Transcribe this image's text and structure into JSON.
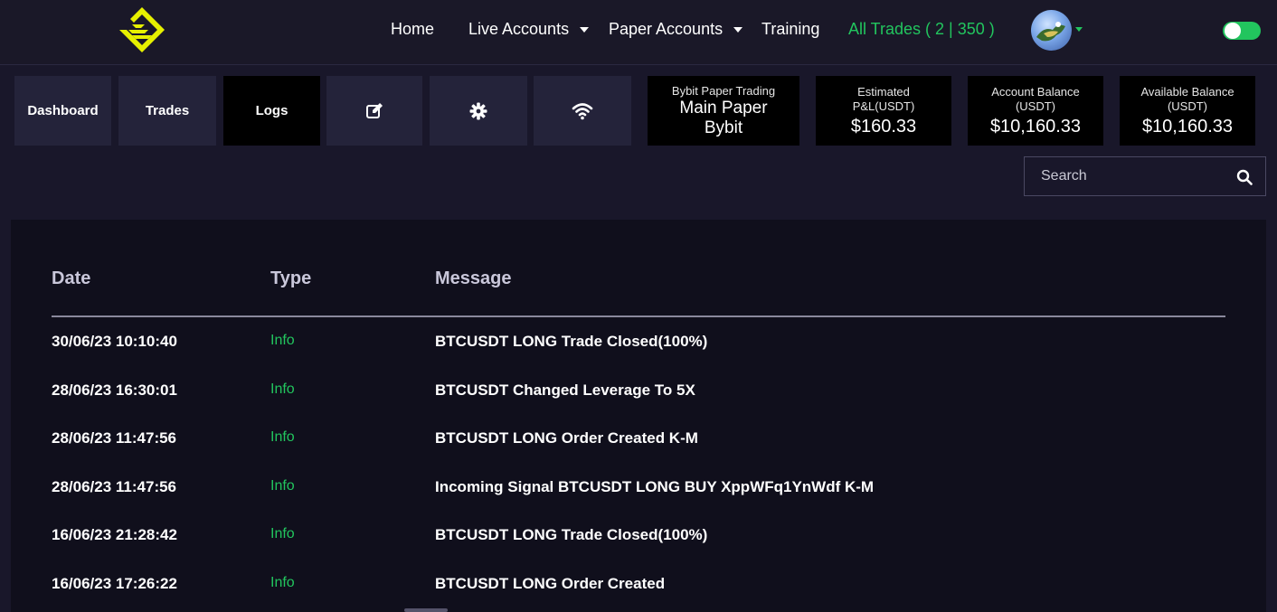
{
  "nav": {
    "home": "Home",
    "live_accounts": "Live Accounts",
    "paper_accounts": "Paper Accounts",
    "training": "Training",
    "all_trades": "All Trades ( 2 | 350 )"
  },
  "toolbar": {
    "dashboard": "Dashboard",
    "trades": "Trades",
    "logs": "Logs",
    "edit_icon": "edit-icon",
    "settings_icon": "gear-icon",
    "wifi_icon": "wifi-icon"
  },
  "account_box": {
    "label": "Bybit Paper Trading",
    "name_line1": "Main Paper",
    "name_line2": "Bybit"
  },
  "stats": [
    {
      "label_line1": "Estimated",
      "label_line2": "P&L(USDT)",
      "value": "$160.33"
    },
    {
      "label_line1": "Account Balance",
      "label_line2": "(USDT)",
      "value": "$10,160.33"
    },
    {
      "label_line1": "Available Balance",
      "label_line2": "(USDT)",
      "value": "$10,160.33"
    }
  ],
  "search": {
    "placeholder": "Search"
  },
  "table": {
    "headers": {
      "date": "Date",
      "type": "Type",
      "message": "Message"
    },
    "rows": [
      {
        "date": "30/06/23 10:10:40",
        "type": "Info",
        "message": "BTCUSDT LONG Trade Closed(100%)"
      },
      {
        "date": "28/06/23 16:30:01",
        "type": "Info",
        "message": "BTCUSDT Changed Leverage To 5X"
      },
      {
        "date": "28/06/23 11:47:56",
        "type": "Info",
        "message": "BTCUSDT LONG Order Created K-M"
      },
      {
        "date": "28/06/23 11:47:56",
        "type": "Info",
        "message": "Incoming Signal BTCUSDT LONG BUY XppWFq1YnWdf K-M"
      },
      {
        "date": "16/06/23 21:28:42",
        "type": "Info",
        "message": "BTCUSDT LONG Trade Closed(100%)"
      },
      {
        "date": "16/06/23 17:26:22",
        "type": "Info",
        "message": "BTCUSDT LONG Order Created"
      }
    ]
  },
  "colors": {
    "accent_green": "#22c55e",
    "logo_yellow": "#e6f000",
    "background": "#19172a",
    "panel": "#100f1c"
  }
}
